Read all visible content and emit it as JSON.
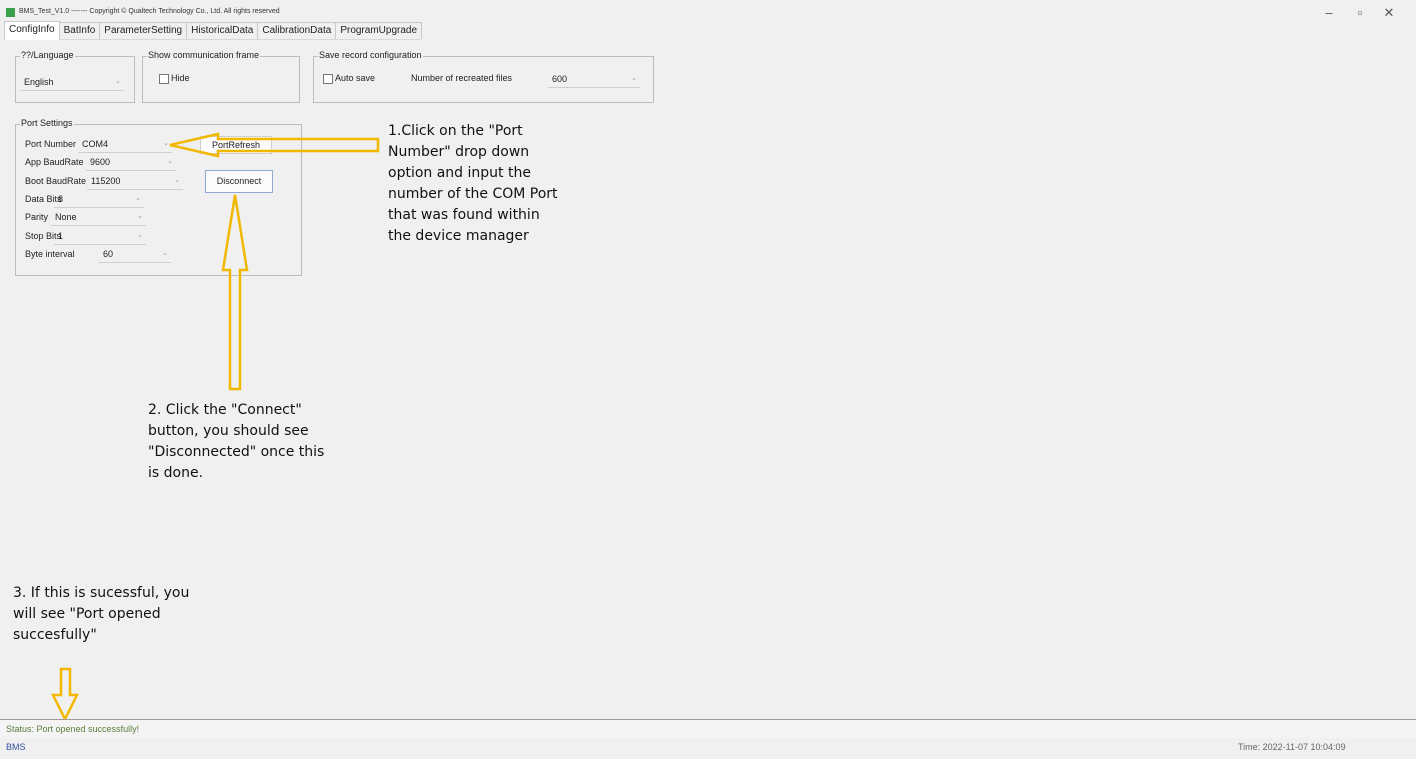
{
  "window": {
    "title": "BMS_Test_V1.0   -------  Copyright © Qualtech Technology Co., Ltd. All rights reserved",
    "buttons": {
      "minimize": "–",
      "restore": "▫",
      "close": "✕"
    }
  },
  "tabs": [
    "ConfigInfo",
    "BatInfo",
    "ParameterSetting",
    "HistoricalData",
    "CalibrationData",
    "ProgramUpgrade"
  ],
  "language_group": {
    "legend": "??/Language",
    "value": "English"
  },
  "comm_group": {
    "legend": "Show communication frame",
    "hide_label": "Hide"
  },
  "record_group": {
    "legend": "Save record configuration",
    "auto_save_label": "Auto save",
    "files_label": "Number of recreated files",
    "files_value": "600"
  },
  "port_settings": {
    "legend": "Port Settings",
    "port_number_label": "Port Number",
    "port_number_value": "COM4",
    "app_baud_label": "App BaudRate",
    "app_baud_value": "9600",
    "boot_baud_label": "Boot BaudRate",
    "boot_baud_value": "115200",
    "data_bits_label": "Data Bits",
    "data_bits_value": "8",
    "parity_label": "Parity",
    "parity_value": "None",
    "stop_bits_label": "Stop Bits",
    "stop_bits_value": "1",
    "byte_interval_label": "Byte interval",
    "byte_interval_value": "60",
    "refresh_button": "PortRefresh",
    "connect_button": "Disconnect"
  },
  "annotations": {
    "step1": [
      "1.Click on the \"Port",
      "Number\" drop down",
      "option and input the",
      "number of the COM Port",
      "that was found within",
      "the device manager"
    ],
    "step2": [
      "2. Click the \"Connect\"",
      "button, you should see",
      "\"Disconnected\" once this",
      "is done."
    ],
    "step3": [
      "3. If this is sucessful, you",
      "will see \"Port opened",
      "succesfully\""
    ]
  },
  "status": {
    "message": "Status: Port opened successfully!",
    "app_name": "BMS",
    "time": "Time: 2022-11-07 10:04:09"
  },
  "colors": {
    "arrow": "#f2b800",
    "status_text": "#5a7f3d",
    "bottom_text": "#3550a0"
  }
}
